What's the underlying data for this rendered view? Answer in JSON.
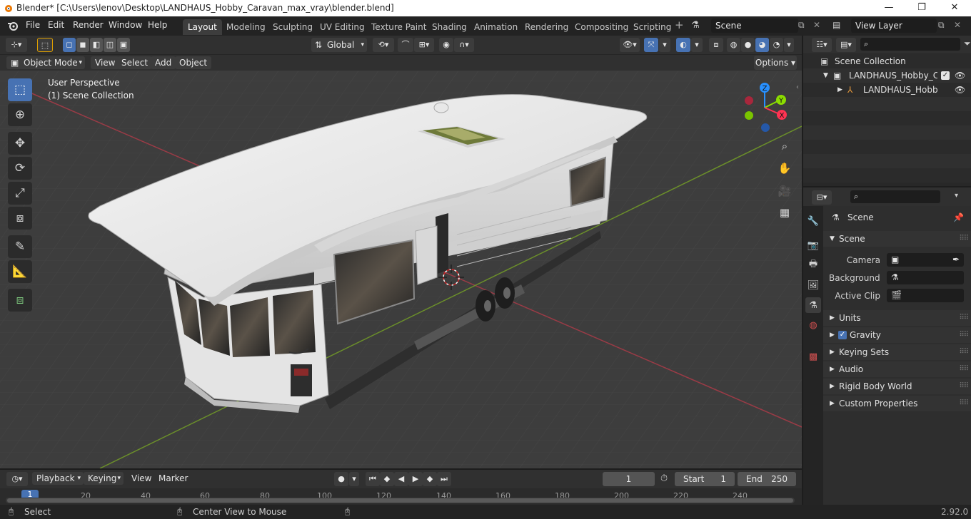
{
  "window": {
    "title": "Blender* [C:\\Users\\lenov\\Desktop\\LANDHAUS_Hobby_Caravan_max_vray\\blender.blend]",
    "minimize": "—",
    "maximize": "❐",
    "close": "✕"
  },
  "menu": [
    "File",
    "Edit",
    "Render",
    "Window",
    "Help"
  ],
  "workspaces": [
    "Layout",
    "Modeling",
    "Sculpting",
    "UV Editing",
    "Texture Paint",
    "Shading",
    "Animation",
    "Rendering",
    "Compositing",
    "Scripting"
  ],
  "active_workspace": "Layout",
  "scene_field": "Scene",
  "view_layer_field": "View Layer",
  "viewport_header": {
    "transform_orientation": "Global",
    "options": "Options"
  },
  "viewport_sub": {
    "mode": "Object Mode",
    "view": "View",
    "select": "Select",
    "add": "Add",
    "object": "Object"
  },
  "viewport": {
    "perspective": "User Perspective",
    "collection": "(1) Scene Collection",
    "gizmo": {
      "z": "Z",
      "y": "Y",
      "x": "X"
    }
  },
  "outliner": {
    "root": "Scene Collection",
    "collection": "LANDHAUS_Hobby_Cara",
    "object": "LANDHAUS_Hobby_("
  },
  "properties": {
    "context": "Scene",
    "panel": "Scene",
    "camera_label": "Camera",
    "background_label": "Background ...",
    "active_clip_label": "Active Clip",
    "sections": [
      "Units",
      "Gravity",
      "Keying Sets",
      "Audio",
      "Rigid Body World",
      "Custom Properties"
    ],
    "gravity_checked": true
  },
  "timeline": {
    "playback": "Playback",
    "keying": "Keying",
    "view": "View",
    "marker": "Marker",
    "current_frame": "1",
    "start_label": "Start",
    "start": "1",
    "end_label": "End",
    "end": "250",
    "ticks": [
      "1",
      "20",
      "40",
      "60",
      "80",
      "100",
      "120",
      "140",
      "160",
      "180",
      "200",
      "220",
      "240"
    ]
  },
  "status": {
    "select": "Select",
    "center_view": "Center View to Mouse",
    "version": "2.92.0"
  },
  "colors": {
    "accent": "#4772b3",
    "x_axis": "#ff3352",
    "y_axis": "#8bdc00",
    "z_axis": "#2890ff"
  }
}
